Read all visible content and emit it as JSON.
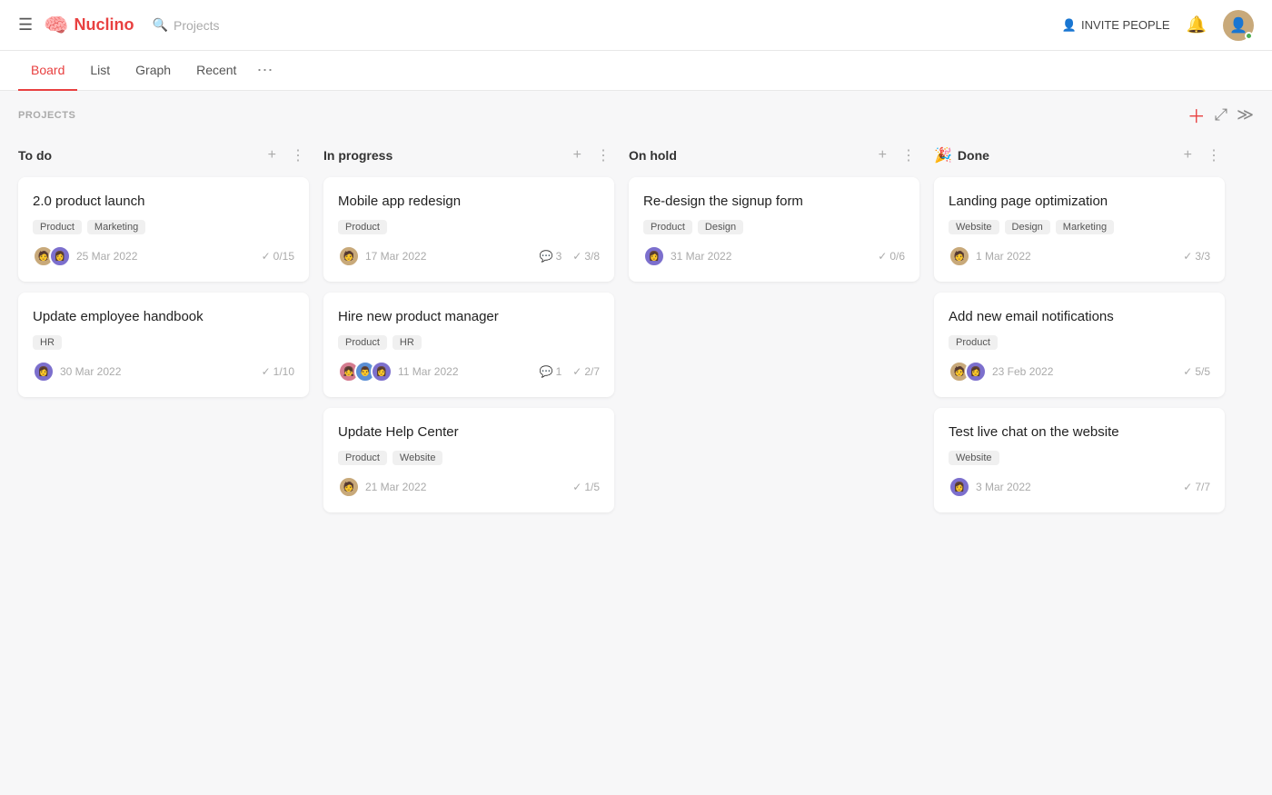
{
  "header": {
    "logo_text": "Nuclino",
    "search_placeholder": "Projects",
    "invite_label": "INVITE PEOPLE"
  },
  "tabs": [
    {
      "id": "board",
      "label": "Board",
      "active": true
    },
    {
      "id": "list",
      "label": "List",
      "active": false
    },
    {
      "id": "graph",
      "label": "Graph",
      "active": false
    },
    {
      "id": "recent",
      "label": "Recent",
      "active": false
    }
  ],
  "toolbar": {
    "section_label": "PROJECTS"
  },
  "columns": [
    {
      "id": "todo",
      "title": "To do",
      "icon": "",
      "cards": [
        {
          "id": "c1",
          "title": "2.0 product launch",
          "tags": [
            "Product",
            "Marketing"
          ],
          "avatars": [
            "tan",
            "purple"
          ],
          "date": "25 Mar 2022",
          "checks": "0/15",
          "comments": null
        },
        {
          "id": "c2",
          "title": "Update employee handbook",
          "tags": [
            "HR"
          ],
          "avatars": [
            "purple"
          ],
          "date": "30 Mar 2022",
          "checks": "1/10",
          "comments": null
        }
      ]
    },
    {
      "id": "inprogress",
      "title": "In progress",
      "icon": "",
      "cards": [
        {
          "id": "c3",
          "title": "Mobile app redesign",
          "tags": [
            "Product"
          ],
          "avatars": [
            "tan"
          ],
          "date": "17 Mar 2022",
          "checks": "3/8",
          "comments": "3"
        },
        {
          "id": "c4",
          "title": "Hire new product manager",
          "tags": [
            "Product",
            "HR"
          ],
          "avatars": [
            "pink",
            "blue",
            "purple"
          ],
          "date": "11 Mar 2022",
          "checks": "2/7",
          "comments": "1"
        },
        {
          "id": "c5",
          "title": "Update Help Center",
          "tags": [
            "Product",
            "Website"
          ],
          "avatars": [
            "tan"
          ],
          "date": "21 Mar 2022",
          "checks": "1/5",
          "comments": null
        }
      ]
    },
    {
      "id": "onhold",
      "title": "On hold",
      "icon": "",
      "cards": [
        {
          "id": "c6",
          "title": "Re-design the signup form",
          "tags": [
            "Product",
            "Design"
          ],
          "avatars": [
            "purple"
          ],
          "date": "31 Mar 2022",
          "checks": "0/6",
          "comments": null
        }
      ]
    },
    {
      "id": "done",
      "title": "Done",
      "icon": "🎉",
      "cards": [
        {
          "id": "c7",
          "title": "Landing page optimization",
          "tags": [
            "Website",
            "Design",
            "Marketing"
          ],
          "avatars": [
            "tan"
          ],
          "date": "1 Mar 2022",
          "checks": "3/3",
          "comments": null
        },
        {
          "id": "c8",
          "title": "Add new email notifications",
          "tags": [
            "Product"
          ],
          "avatars": [
            "tan",
            "purple"
          ],
          "date": "23 Feb 2022",
          "checks": "5/5",
          "comments": null
        },
        {
          "id": "c9",
          "title": "Test live chat on the website",
          "tags": [
            "Website"
          ],
          "avatars": [
            "purple"
          ],
          "date": "3 Mar 2022",
          "checks": "7/7",
          "comments": null
        }
      ]
    }
  ]
}
